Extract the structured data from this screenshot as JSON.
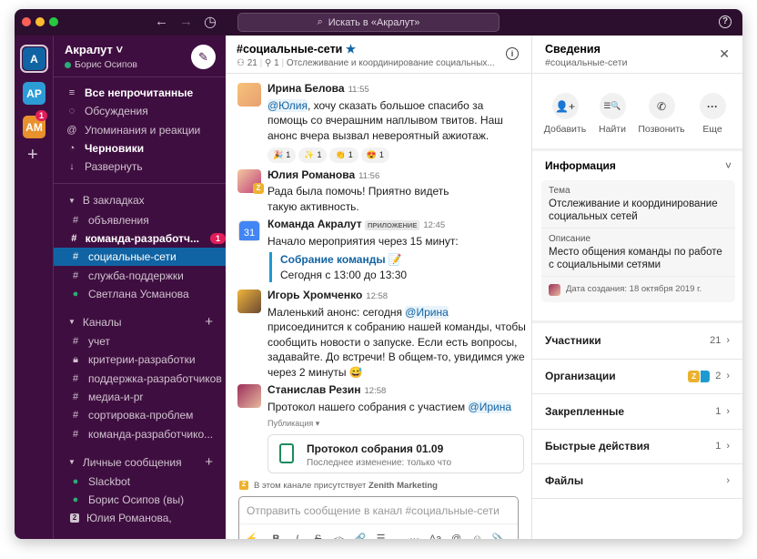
{
  "titlebar": {
    "search_placeholder": "Искать в «Акралут»",
    "back": "←",
    "forward": "→",
    "history": "◷",
    "help": "?"
  },
  "rail": {
    "workspaces": [
      {
        "label": "A",
        "color": "#1164a3"
      },
      {
        "label": "AP",
        "color": "#2c9bd6"
      },
      {
        "label": "AM",
        "color": "#e8912d",
        "badge": "1"
      }
    ],
    "add": "+"
  },
  "sidebar": {
    "workspace_name": "Акралут",
    "user": "Борис Осипов",
    "nav": [
      {
        "label": "Все непрочитанные",
        "bold": true
      },
      {
        "label": "Обсуждения"
      },
      {
        "label": "Упоминания и реакции"
      },
      {
        "label": "Черновики",
        "bold": true
      },
      {
        "label": "Развернуть"
      }
    ],
    "bookmarks_title": "В закладках",
    "bookmarks": [
      {
        "label": "объявления"
      },
      {
        "label": "команда-разработч...",
        "badge": "1"
      },
      {
        "label": "социальные-сети",
        "selected": true
      },
      {
        "label": "служба-поддержки"
      },
      {
        "label": "Светлана Усманова"
      }
    ],
    "channels_title": "Каналы",
    "channels": [
      "учет",
      "критерии-разработки",
      "поддержка-разработчиков",
      "медиа-и-pr",
      "сортировка-проблем",
      "команда-разработчико..."
    ],
    "dms_title": "Личные сообщения",
    "dms": [
      "Slackbot",
      "Борис Осипов (вы)",
      "Юлия Романова,"
    ],
    "dm_group_count": "2"
  },
  "channel": {
    "name": "#социальные-сети",
    "members": "21",
    "pins": "1",
    "topic": "Отслеживание и координирование социальных..."
  },
  "messages": [
    {
      "author": "Ирина Белова",
      "time": "11:55",
      "mention": "@Юлия",
      "text": ", хочу сказать большое спасибо за помощь со вчерашним наплывом твитов. Наш анонс вчера вызвал невероятный ажиотаж.",
      "reactions": [
        {
          "emoji": "🎉",
          "count": "1"
        },
        {
          "emoji": "✨",
          "count": "1"
        },
        {
          "emoji": "👏",
          "count": "1"
        },
        {
          "emoji": "😍",
          "count": "1"
        }
      ]
    },
    {
      "author": "Юлия Романова",
      "time": "11:56",
      "text": "Рада была помочь! Приятно видеть такую активность.",
      "org_badge": "Z"
    },
    {
      "author": "Команда Акралут",
      "badge": "ПРИЛОЖЕНИЕ",
      "time": "12:45",
      "text": "Начало мероприятия через 15 минут:",
      "event_title": "Собрание команды",
      "event_emoji": "📝",
      "event_time": "Сегодня с 13:00 до 13:30",
      "calendar_day": "31"
    },
    {
      "author": "Игорь Хромченко",
      "time": "12:58",
      "text_before": "Маленький анонс: сегодня ",
      "mention": "@Ирина",
      "text_after": " присоединится к собранию нашей команды, чтобы сообщить новости о запуске. Если есть вопросы, задавайте. До встречи! В общем-то, увидимся уже через 2 минуты 😅"
    },
    {
      "author": "Станислав Резин",
      "time": "12:58",
      "text": "Протокол нашего собрания с участием ",
      "mention": "@Ирина",
      "post_label": "Публикация ▾",
      "file_title": "Протокол собрания 01.09",
      "file_sub": "Последнее изменение: только что"
    }
  ],
  "shared_notice": {
    "prefix": "В этом канале присутствует ",
    "org": "Zenith Marketing",
    "badge": "Z"
  },
  "composer": {
    "placeholder": "Отправить сообщение в канал #социальные-сети",
    "tools": [
      "⚡",
      "B",
      "I",
      "S",
      "</>",
      "🔗",
      "☰",
      "···",
      "Aa",
      "@",
      "☺",
      "📎"
    ]
  },
  "details": {
    "title": "Сведения",
    "subtitle": "#социальные-сети",
    "close": "✕",
    "actions": [
      {
        "label": "Добавить",
        "icon": "👤+"
      },
      {
        "label": "Найти",
        "icon": "☰🔍"
      },
      {
        "label": "Позвонить",
        "icon": "✆"
      },
      {
        "label": "Еще",
        "icon": "···"
      }
    ],
    "info_title": "Информация",
    "topic_label": "Тема",
    "topic": "Отслеживание и координирование социальных сетей",
    "desc_label": "Описание",
    "desc": "Место общения команды по работе с социальными сетями",
    "created": "Дата создания: 18 октября 2019 г.",
    "rows": [
      {
        "label": "Участники",
        "count": "21"
      },
      {
        "label": "Организации",
        "count": "2",
        "org": "Z"
      },
      {
        "label": "Закрепленные",
        "count": "1"
      },
      {
        "label": "Быстрые действия",
        "count": "1"
      },
      {
        "label": "Файлы",
        "count": ""
      }
    ]
  }
}
